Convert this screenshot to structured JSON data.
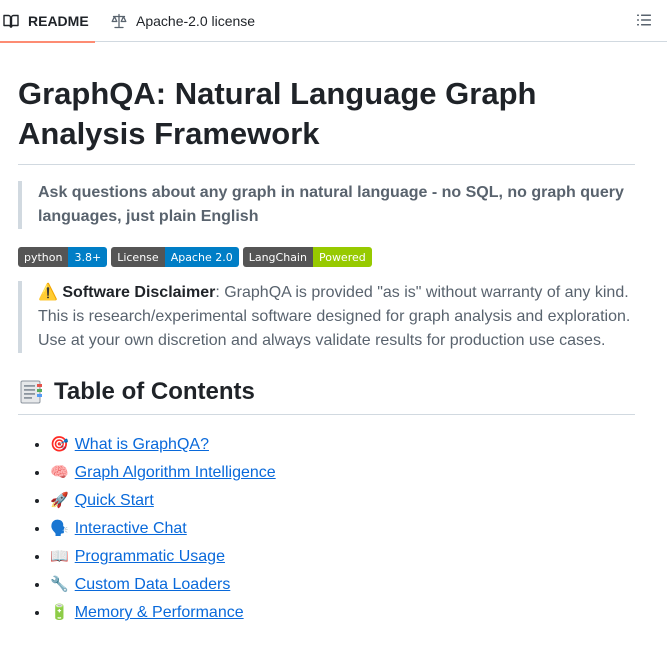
{
  "tabs": {
    "readme_label": "README",
    "license_label": "Apache-2.0 license"
  },
  "content": {
    "title": "GraphQA: Natural Language Graph Analysis Framework",
    "tagline": "Ask questions about any graph in natural language - no SQL, no graph query languages, just plain English",
    "badges": [
      {
        "label": "python",
        "value": "3.8+",
        "color": "#007ec6"
      },
      {
        "label": "License",
        "value": "Apache 2.0",
        "color": "#007ec6"
      },
      {
        "label": "LangChain",
        "value": "Powered",
        "color": "#97ca00"
      }
    ],
    "disclaimer": {
      "icon": "⚠️",
      "bold": "Software Disclaimer",
      "text": ": GraphQA is provided \"as is\" without warranty of any kind. This is research/experimental software designed for graph analysis and exploration. Use at your own discretion and always validate results for production use cases."
    },
    "toc_heading": "Table of Contents",
    "toc_items": [
      {
        "emoji": "🎯",
        "label": "What is GraphQA?"
      },
      {
        "emoji": "🧠",
        "label": "Graph Algorithm Intelligence"
      },
      {
        "emoji": "🚀",
        "label": "Quick Start"
      },
      {
        "emoji": "🗣️",
        "label": "Interactive Chat"
      },
      {
        "emoji": "📖",
        "label": "Programmatic Usage"
      },
      {
        "emoji": "🔧",
        "label": "Custom Data Loaders"
      },
      {
        "emoji": "🔋",
        "label": "Memory & Performance"
      }
    ]
  },
  "colors": {
    "link": "#0969da",
    "tab_underline": "#fd8c73",
    "badge_left": "#555555"
  }
}
